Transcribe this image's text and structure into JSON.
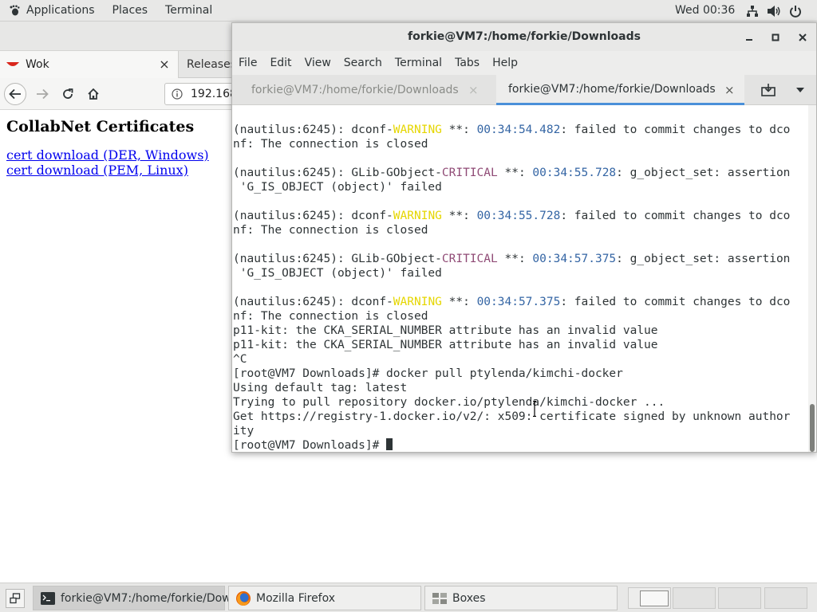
{
  "topbar": {
    "applications": "Applications",
    "places": "Places",
    "terminal": "Terminal",
    "clock": "Wed 00:36",
    "tray_icons": [
      "network-icon",
      "volume-icon",
      "power-icon"
    ]
  },
  "firefox": {
    "tabs": [
      {
        "label": "Wok",
        "close": "×"
      },
      {
        "label": "Releases"
      }
    ],
    "url": "192.168",
    "page": {
      "heading": "CollabNet Certificates",
      "links": [
        "cert download (DER, Windows)",
        "cert download (PEM, Linux)"
      ]
    }
  },
  "terminal": {
    "title": "forkie@VM7:/home/forkie/Downloads",
    "menu": [
      "File",
      "Edit",
      "View",
      "Search",
      "Terminal",
      "Tabs",
      "Help"
    ],
    "tabs": [
      {
        "label": "forkie@VM7:/home/forkie/Downloads",
        "close": "×"
      },
      {
        "label": "forkie@VM7:/home/forkie/Downloads",
        "close": "×"
      }
    ],
    "active_tab": 1,
    "lines": [
      [
        {
          "t": "(nautilus:6245): dconf-"
        },
        {
          "t": "WARNING",
          "c": "warn"
        },
        {
          "t": " **: "
        },
        {
          "t": "00:34:54.482",
          "c": "time"
        },
        {
          "t": ": failed to commit changes to dco"
        }
      ],
      [
        {
          "t": "nf: The connection is closed"
        }
      ],
      [
        {
          "t": ""
        }
      ],
      [
        {
          "t": "(nautilus:6245): GLib-GObject-"
        },
        {
          "t": "CRITICAL",
          "c": "crit"
        },
        {
          "t": " **: "
        },
        {
          "t": "00:34:55.728",
          "c": "time"
        },
        {
          "t": ": g_object_set: assertion"
        }
      ],
      [
        {
          "t": " 'G_IS_OBJECT (object)' failed"
        }
      ],
      [
        {
          "t": ""
        }
      ],
      [
        {
          "t": "(nautilus:6245): dconf-"
        },
        {
          "t": "WARNING",
          "c": "warn"
        },
        {
          "t": " **: "
        },
        {
          "t": "00:34:55.728",
          "c": "time"
        },
        {
          "t": ": failed to commit changes to dco"
        }
      ],
      [
        {
          "t": "nf: The connection is closed"
        }
      ],
      [
        {
          "t": ""
        }
      ],
      [
        {
          "t": "(nautilus:6245): GLib-GObject-"
        },
        {
          "t": "CRITICAL",
          "c": "crit"
        },
        {
          "t": " **: "
        },
        {
          "t": "00:34:57.375",
          "c": "time"
        },
        {
          "t": ": g_object_set: assertion"
        }
      ],
      [
        {
          "t": " 'G_IS_OBJECT (object)' failed"
        }
      ],
      [
        {
          "t": ""
        }
      ],
      [
        {
          "t": "(nautilus:6245): dconf-"
        },
        {
          "t": "WARNING",
          "c": "warn"
        },
        {
          "t": " **: "
        },
        {
          "t": "00:34:57.375",
          "c": "time"
        },
        {
          "t": ": failed to commit changes to dco"
        }
      ],
      [
        {
          "t": "nf: The connection is closed"
        }
      ],
      [
        {
          "t": "p11-kit: the CKA_SERIAL_NUMBER attribute has an invalid value"
        }
      ],
      [
        {
          "t": "p11-kit: the CKA_SERIAL_NUMBER attribute has an invalid value"
        }
      ],
      [
        {
          "t": "^C"
        }
      ],
      [
        {
          "t": "[root@VM7 Downloads]# docker pull ptylenda/kimchi-docker"
        }
      ],
      [
        {
          "t": "Using default tag: latest"
        }
      ],
      [
        {
          "t": "Trying to pull repository docker.io/ptylenda/kimchi-docker ..."
        }
      ],
      [
        {
          "t": "Get https://registry-1.docker.io/v2/: x509: certificate signed by unknown author"
        }
      ],
      [
        {
          "t": "ity"
        }
      ],
      [
        {
          "t": "[root@VM7 Downloads]# "
        }
      ]
    ],
    "colors": {
      "warning": "#e5d600",
      "critical": "#8f4a75",
      "timestamp": "#3465a4"
    }
  },
  "taskbar": {
    "tasks": [
      {
        "label": "forkie@VM7:/home/forkie/Dow...",
        "icon": "terminal-icon"
      },
      {
        "label": "Mozilla Firefox",
        "icon": "firefox-icon"
      },
      {
        "label": "Boxes",
        "icon": "boxes-icon"
      }
    ],
    "workspaces": 4,
    "active_workspace": 1
  }
}
